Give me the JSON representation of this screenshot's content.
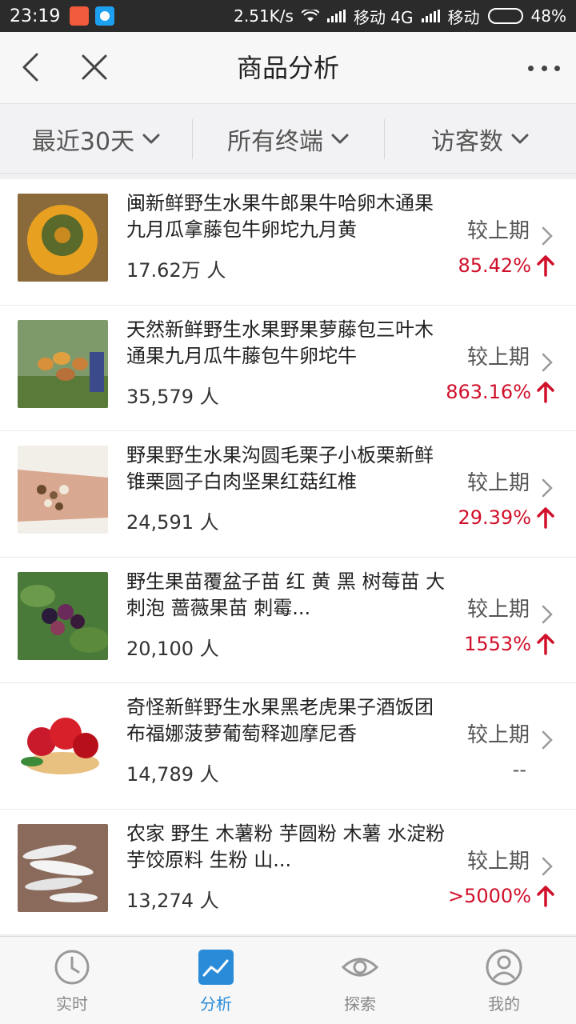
{
  "status_bar": {
    "time": "23:19",
    "speed": "2.51K/s",
    "carrier1": "移动 4G",
    "carrier2": "移动",
    "battery": "48%"
  },
  "header": {
    "title": "商品分析"
  },
  "filters": [
    {
      "label": "最近30天"
    },
    {
      "label": "所有终端"
    },
    {
      "label": "访客数"
    }
  ],
  "items": [
    {
      "title": "闽新鲜野生水果牛郎果牛哈卵木通果九月瓜拿藤包牛卵坨九月黄",
      "count": "17.62万 人",
      "compare_label": "较上期",
      "change": "85.42%",
      "trend": "up"
    },
    {
      "title": "天然新鲜野生水果野果萝藤包三叶木通果九月瓜牛藤包牛卵坨牛",
      "count": "35,579 人",
      "compare_label": "较上期",
      "change": "863.16%",
      "trend": "up"
    },
    {
      "title": "野果野生水果沟圆毛栗子小板栗新鲜锥栗圆子白肉坚果红菇红椎",
      "count": "24,591 人",
      "compare_label": "较上期",
      "change": "29.39%",
      "trend": "up"
    },
    {
      "title": "野生果苗覆盆子苗 红 黄 黑 树莓苗 大刺泡 蔷薇果苗 刺霉...",
      "count": "20,100 人",
      "compare_label": "较上期",
      "change": "1553%",
      "trend": "up"
    },
    {
      "title": "奇怪新鲜野生水果黑老虎果子酒饭团布福娜菠萝葡萄释迦摩尼香",
      "count": "14,789 人",
      "compare_label": "较上期",
      "change": "--",
      "trend": "none"
    },
    {
      "title": "农家 野生 木薯粉 芋圆粉 木薯 水淀粉 芋饺原料 生粉 山...",
      "count": "13,274 人",
      "compare_label": "较上期",
      "change": ">5000%",
      "trend": "up"
    }
  ],
  "tabs": [
    {
      "label": "实时",
      "icon": "clock-icon"
    },
    {
      "label": "分析",
      "icon": "chart-icon"
    },
    {
      "label": "探索",
      "icon": "eye-icon"
    },
    {
      "label": "我的",
      "icon": "user-icon"
    }
  ],
  "colors": {
    "accent": "#2a8cd9",
    "up": "#d0102a"
  }
}
